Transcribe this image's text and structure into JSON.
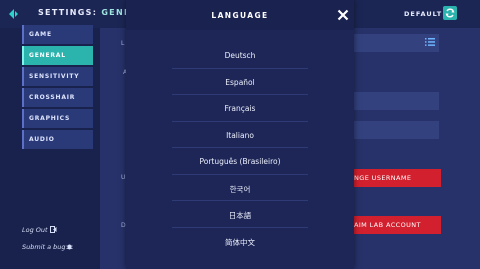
{
  "header": {
    "title_prefix": "SETTINGS: ",
    "title_tab": "GENERAL",
    "default_label": "DEFAULT"
  },
  "sidebar": {
    "items": [
      {
        "label": "GAME"
      },
      {
        "label": "GENERAL"
      },
      {
        "label": "SENSITIVITY"
      },
      {
        "label": "CROSSHAIR"
      },
      {
        "label": "GRAPHICS"
      },
      {
        "label": "AUDIO"
      }
    ],
    "logout_label": "Log Out",
    "submit_bug_label": "Submit a bug"
  },
  "main": {
    "change_username_label": "NGE USERNAME",
    "aimlab_account_label": "AIM LAB ACCOUNT",
    "frag_l": "L",
    "frag_a": "A",
    "frag_u": "U",
    "frag_d": "D"
  },
  "modal": {
    "title": "LANGUAGE",
    "languages": [
      "Deutsch",
      "Español",
      "Français",
      "Italiano",
      "Português (Brasileiro)",
      "한국어",
      "日本語",
      "简体中文"
    ]
  },
  "colors": {
    "accent_teal": "#2bb3ae",
    "button_red": "#d3202e",
    "background": "#1f2a5a"
  }
}
